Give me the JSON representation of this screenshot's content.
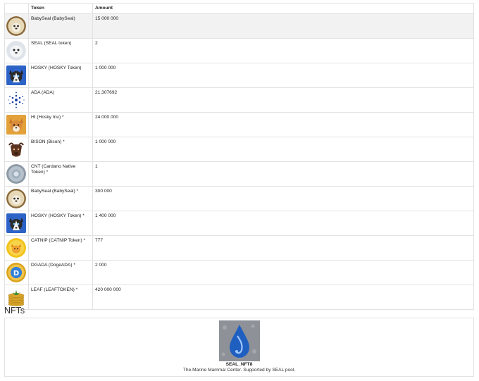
{
  "table": {
    "headers": {
      "token": "Token",
      "amount": "Amount"
    },
    "rows": [
      {
        "icon": "babyseal-logo-icon",
        "name": "BabySeal (BabySeal)",
        "amount": "15 000 000",
        "highlight": true
      },
      {
        "icon": "seal-logo-icon",
        "name": "SEAL (SEAL token)",
        "amount": "2"
      },
      {
        "icon": "husky-logo-icon",
        "name": "HOSKY (HOSKY Token)",
        "amount": "1 000 000"
      },
      {
        "icon": "cardano-logo-icon",
        "name": "ADA (ADA)",
        "amount": "21.307692"
      },
      {
        "icon": "hosky-inu-logo-icon",
        "name": "HI (Hosky Inu) *",
        "amount": "24 000 000"
      },
      {
        "icon": "bison-logo-icon",
        "name": "BISON (Bison) *",
        "amount": "1 000 000"
      },
      {
        "icon": "cnt-logo-icon",
        "name": "CNT (Cardano Native Token) *",
        "amount": "1"
      },
      {
        "icon": "babyseal-logo-icon",
        "name": "BabySeal (BabySeal) *",
        "amount": "300 000"
      },
      {
        "icon": "husky-logo-icon",
        "name": "HOSKY (HOSKY Token) *",
        "amount": "1 400 000"
      },
      {
        "icon": "catnip-logo-icon",
        "name": "CATNIP (CATNIP Token) *",
        "amount": "777"
      },
      {
        "icon": "dogeada-logo-icon",
        "name": "DGADA (DogeADA) *",
        "amount": "2 000"
      },
      {
        "icon": "leaf-coins-logo-icon",
        "name": "LEAF (LEAFTOKEN) *",
        "amount": "420 000 000"
      }
    ]
  },
  "nfts": {
    "title": "NFTs",
    "items": [
      {
        "icon": "seal-nft-drop-image",
        "name": "SEAL_NFT8",
        "description": "The Marine Mammal Center. Supported by SEAL pool."
      }
    ]
  }
}
